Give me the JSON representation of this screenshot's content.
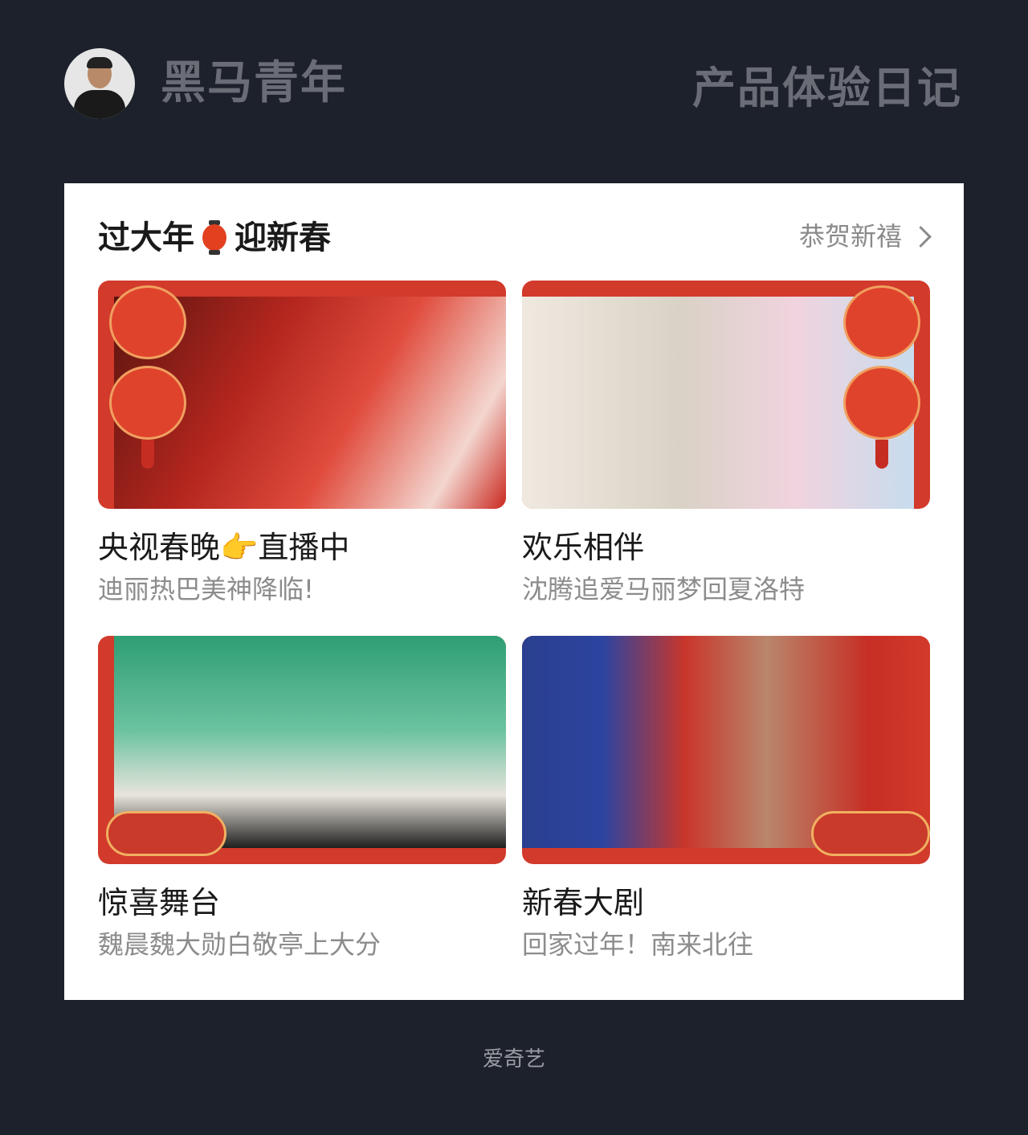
{
  "header": {
    "brand": "黑马青年",
    "diary": "产品体验日记"
  },
  "section": {
    "title_left": "过大年",
    "title_right": "迎新春",
    "more_label": "恭贺新禧"
  },
  "tiles": [
    {
      "title": "央视春晚👉直播中",
      "subtitle": "迪丽热巴美神降临!"
    },
    {
      "title": "欢乐相伴",
      "subtitle": "沈腾追爱马丽梦回夏洛特"
    },
    {
      "title": "惊喜舞台",
      "subtitle": "魏晨魏大勋白敬亭上大分"
    },
    {
      "title": "新春大剧",
      "subtitle": "回家过年！南来北往"
    }
  ],
  "footer": "爱奇艺",
  "colors": {
    "background": "#1d212b",
    "card": "#ffffff",
    "festive_red": "#d23a2b",
    "muted_text": "#8c8c8c"
  }
}
